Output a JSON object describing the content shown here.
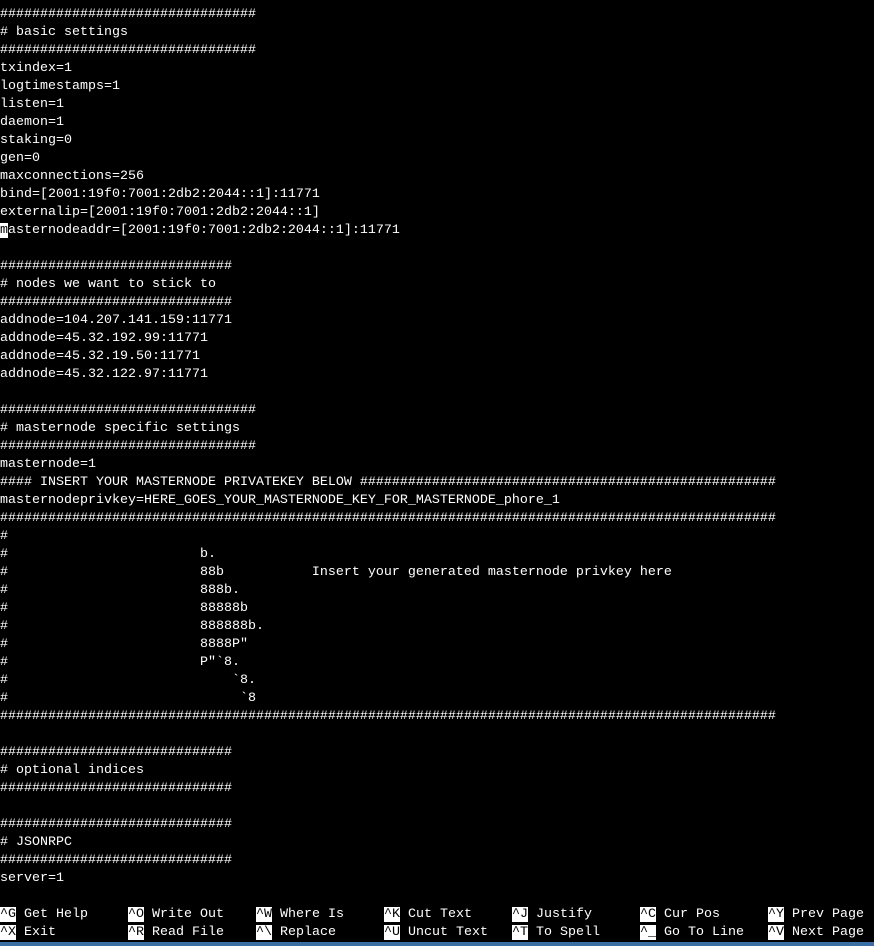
{
  "editor": {
    "cursor_line_index": 12,
    "lines": [
      "################################",
      "# basic settings",
      "################################",
      "txindex=1",
      "logtimestamps=1",
      "listen=1",
      "daemon=1",
      "staking=0",
      "gen=0",
      "maxconnections=256",
      "bind=[2001:19f0:7001:2db2:2044::1]:11771",
      "externalip=[2001:19f0:7001:2db2:2044::1]",
      "masternodeaddr=[2001:19f0:7001:2db2:2044::1]:11771",
      "",
      "#############################",
      "# nodes we want to stick to",
      "#############################",
      "addnode=104.207.141.159:11771",
      "addnode=45.32.192.99:11771",
      "addnode=45.32.19.50:11771",
      "addnode=45.32.122.97:11771",
      "",
      "################################",
      "# masternode specific settings",
      "################################",
      "masternode=1",
      "#### INSERT YOUR MASTERNODE PRIVATEKEY BELOW ####################################################",
      "masternodeprivkey=HERE_GOES_YOUR_MASTERNODE_KEY_FOR_MASTERNODE_phore_1",
      "#################################################################################################",
      "#",
      "#                        b.",
      "#                        88b           Insert your generated masternode privkey here",
      "#                        888b.",
      "#                        88888b",
      "#                        888888b.",
      "#                        8888P\"",
      "#                        P\"`8.",
      "#                            `8.",
      "#                             `8",
      "#################################################################################################",
      "",
      "#############################",
      "# optional indices",
      "#############################",
      "",
      "#############################",
      "# JSONRPC",
      "#############################",
      "server=1"
    ]
  },
  "shortcuts": [
    [
      {
        "key": "^G",
        "label": "Get Help"
      },
      {
        "key": "^O",
        "label": "Write Out"
      },
      {
        "key": "^W",
        "label": "Where Is"
      },
      {
        "key": "^K",
        "label": "Cut Text"
      },
      {
        "key": "^J",
        "label": "Justify"
      },
      {
        "key": "^C",
        "label": "Cur Pos"
      },
      {
        "key": "^Y",
        "label": "Prev Page"
      }
    ],
    [
      {
        "key": "^X",
        "label": "Exit"
      },
      {
        "key": "^R",
        "label": "Read File"
      },
      {
        "key": "^\\",
        "label": "Replace"
      },
      {
        "key": "^U",
        "label": "Uncut Text"
      },
      {
        "key": "^T",
        "label": "To Spell"
      },
      {
        "key": "^_",
        "label": "Go To Line"
      },
      {
        "key": "^V",
        "label": "Next Page"
      }
    ]
  ],
  "colors": {
    "background": "#000000",
    "text": "#ffffff",
    "window_border": "#3a6ea5"
  }
}
